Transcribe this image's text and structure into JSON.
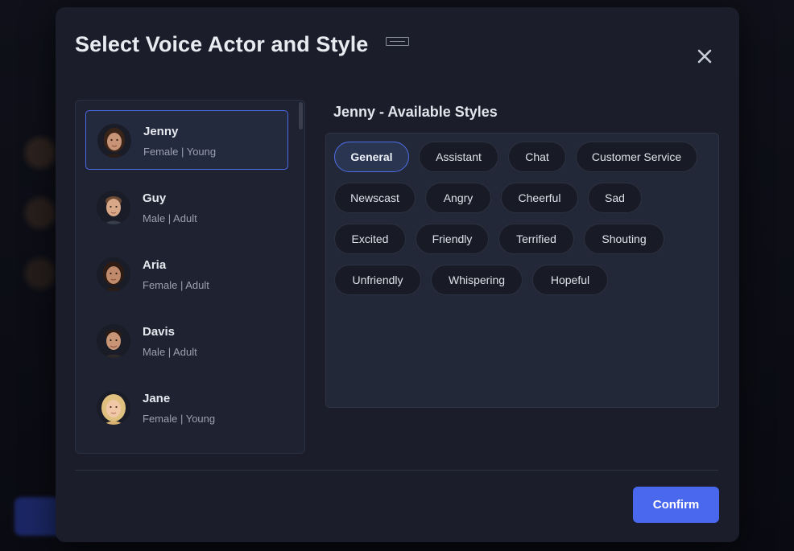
{
  "modal": {
    "title": "Select Voice Actor and Style",
    "close_icon": "close-icon",
    "confirm_label": "Confirm"
  },
  "voices": [
    {
      "name": "Jenny",
      "meta": "Female | Young",
      "avatar": "avatar-female-dark-hair",
      "selected": true
    },
    {
      "name": "Guy",
      "meta": "Male | Adult",
      "avatar": "avatar-male-short-hair",
      "selected": false
    },
    {
      "name": "Aria",
      "meta": "Female | Adult",
      "avatar": "avatar-female-dark-hair",
      "selected": false
    },
    {
      "name": "Davis",
      "meta": "Male | Adult",
      "avatar": "avatar-male-dark-hair",
      "selected": false
    },
    {
      "name": "Jane",
      "meta": "Female | Young",
      "avatar": "avatar-female-blonde",
      "selected": false
    }
  ],
  "styles": {
    "heading": "Jenny - Available Styles",
    "items": [
      {
        "label": "General",
        "selected": true
      },
      {
        "label": "Assistant"
      },
      {
        "label": "Chat"
      },
      {
        "label": "Customer Service"
      },
      {
        "label": "Newscast"
      },
      {
        "label": "Angry"
      },
      {
        "label": "Cheerful"
      },
      {
        "label": "Sad"
      },
      {
        "label": "Excited"
      },
      {
        "label": "Friendly"
      },
      {
        "label": "Terrified"
      },
      {
        "label": "Shouting"
      },
      {
        "label": "Unfriendly"
      },
      {
        "label": "Whispering"
      },
      {
        "label": "Hopeful"
      }
    ]
  },
  "colors": {
    "accent": "#4a68ee",
    "modal_bg": "#1b1e2a",
    "selected_border": "#4b6be6"
  }
}
